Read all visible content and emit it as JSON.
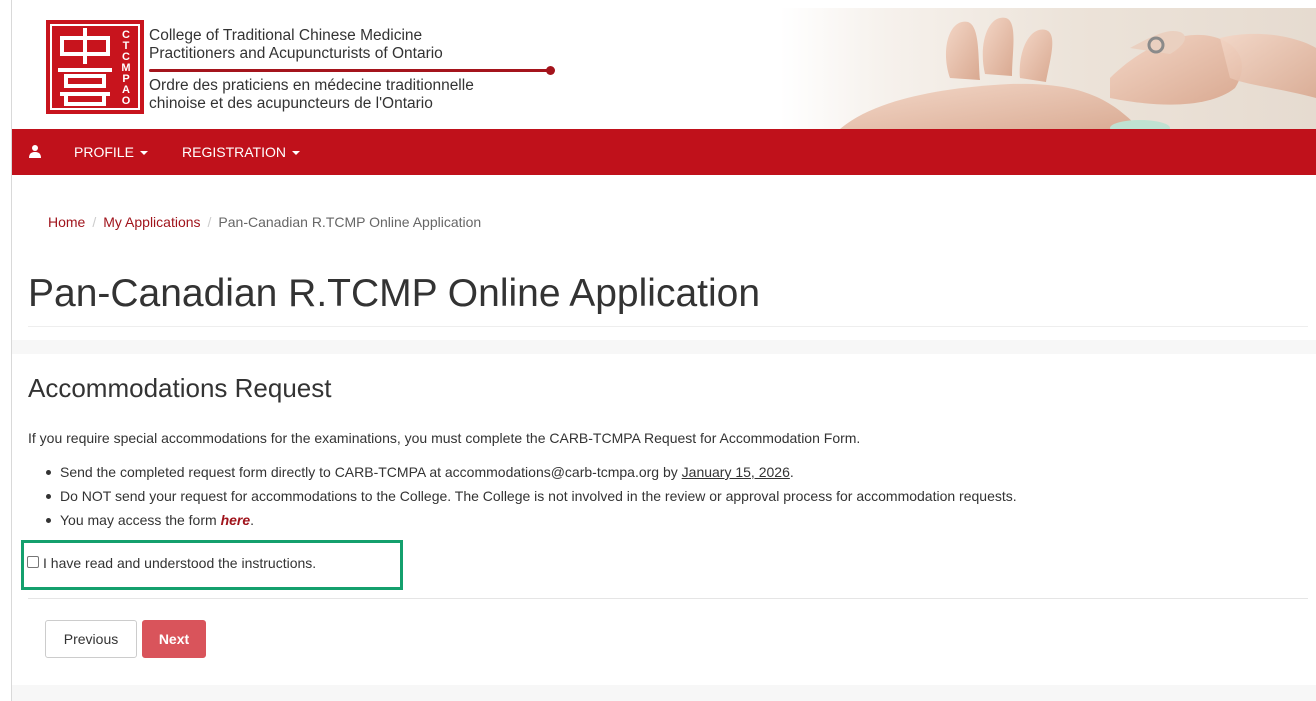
{
  "header": {
    "logo_en_line1": "College of Traditional Chinese Medicine",
    "logo_en_line2": "Practitioners and Acupuncturists of Ontario",
    "logo_fr_line1": "Ordre des praticiens en médecine traditionnelle",
    "logo_fr_line2": "chinoise et des acupuncteurs de l'Ontario",
    "logo_mark_letters": "CTCMPAO"
  },
  "nav": {
    "user_icon": "user-icon",
    "items": [
      {
        "label": "PROFILE"
      },
      {
        "label": "REGISTRATION"
      }
    ]
  },
  "breadcrumb": {
    "home": "Home",
    "applications": "My Applications",
    "current": "Pan-Canadian R.TCMP Online Application"
  },
  "page": {
    "title": "Pan-Canadian R.TCMP Online Application"
  },
  "section": {
    "title": "Accommodations Request",
    "intro": "If you require special accommodations for the examinations, you must complete the CARB-TCMPA Request for Accommodation Form.",
    "bullet1_text": "Send the completed request form directly to CARB-TCMPA at accommodations@carb-tcmpa.org by ",
    "bullet1_date": "January 15, 2026",
    "bullet1_end": ".",
    "bullet2": "Do NOT send your request for accommodations to the College. The College is not involved in the review or approval process for accommodation requests.",
    "bullet3_text": "You may access the form ",
    "bullet3_link": "here",
    "bullet3_end": ".",
    "checkbox_label": "I have read and understood the instructions.",
    "checkbox_checked": false
  },
  "buttons": {
    "previous": "Previous",
    "next": "Next"
  },
  "colors": {
    "brand_red": "#c0111b",
    "link_red": "#a0141c",
    "next_button": "#d9545b",
    "highlight_green": "#14a06d"
  }
}
